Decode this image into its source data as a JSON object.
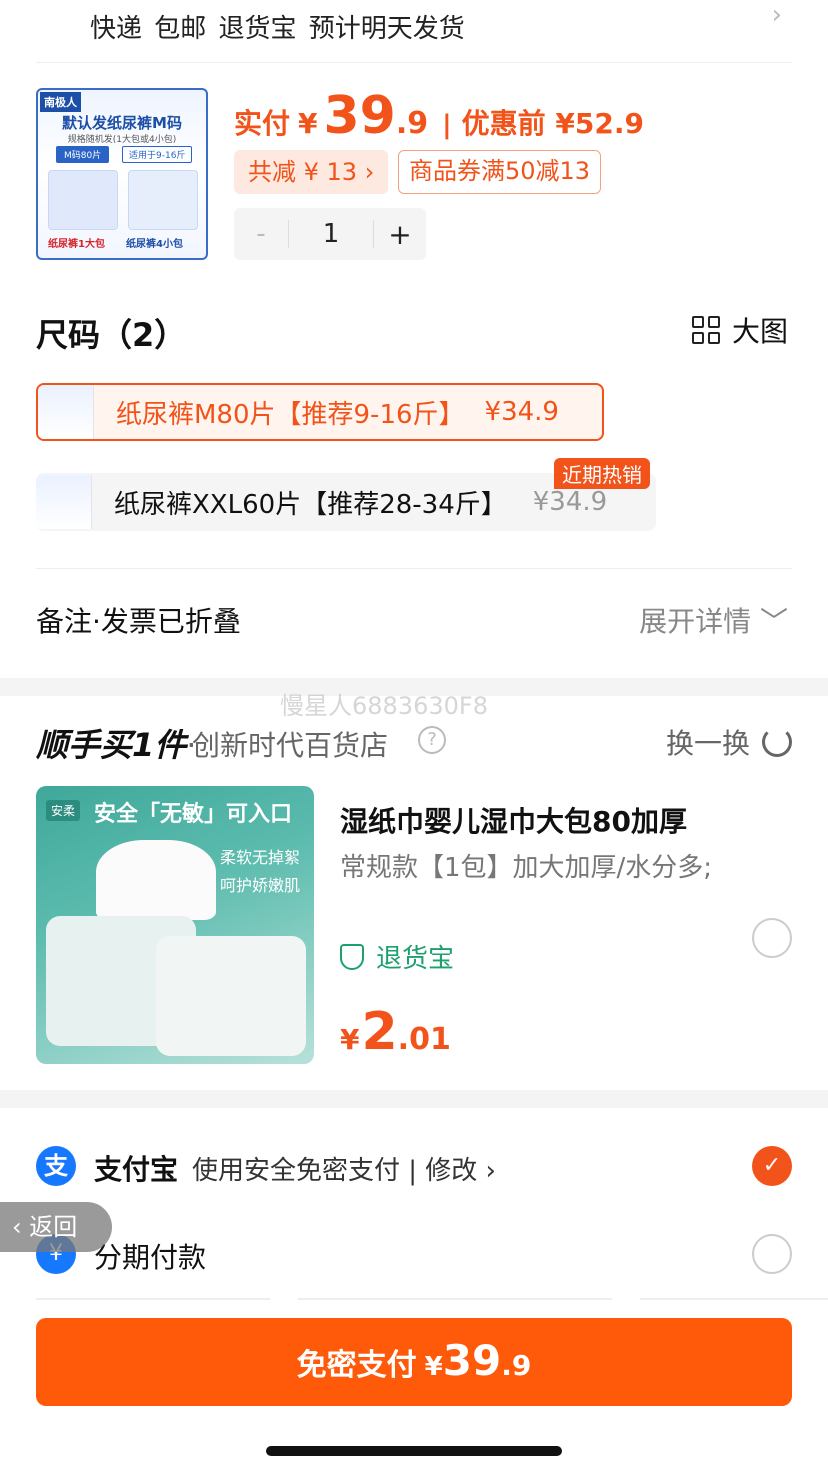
{
  "shipping": {
    "text": "快递 包邮 退货宝 预计明天发货",
    "chevron": "›"
  },
  "product": {
    "image": {
      "brand": "南极人",
      "title": "默认发纸尿裤M码",
      "subtitle": "规格随机发(1大包或4小包)",
      "tag_size": "M码80片",
      "tag_weight": "适用于9-16斤",
      "label_left": "纸尿裤1大包",
      "label_right": "纸尿裤4小包"
    },
    "price_label": "实付",
    "currency": "¥",
    "price_int": "39",
    "price_dec": ".9",
    "separator": "|",
    "before_price": "优惠前 ¥52.9",
    "discount_chip": "共减 ¥ 13 ›",
    "coupon_chip": "商品券满50减13",
    "stepper": {
      "minus": "-",
      "qty": "1",
      "plus": "+"
    }
  },
  "size": {
    "title": "尺码（2）",
    "big_image": "大图",
    "options": [
      {
        "name": "纸尿裤M80片【推荐9-16斤】",
        "price": "¥34.9",
        "selected": true
      },
      {
        "name": "纸尿裤XXL60片【推荐28-34斤】",
        "price": "¥34.9",
        "selected": false
      }
    ],
    "hot_badge": "近期热销"
  },
  "note": {
    "label": "备注·发票已折叠",
    "expand": "展开详情 ﹀"
  },
  "watermark": "慢星人6883630F8",
  "buy_one": {
    "title": "顺手买1件",
    "dot": "·",
    "shop": "创新时代百货店",
    "help": "?",
    "swap": "换一换",
    "item": {
      "image": {
        "tag": "安柔",
        "headline": "安全「无敏」可入口",
        "line1": "柔软无掉絮",
        "line2": "呵护娇嫩肌"
      },
      "title": "湿纸巾婴儿湿巾大包80加厚",
      "spec": "常规款【1包】加大加厚/水分多;",
      "return": "退货宝",
      "currency": "¥",
      "price_int": "2",
      "price_dec": ".01"
    }
  },
  "payment": {
    "alipay_icon": "支",
    "alipay_name": "支付宝",
    "alipay_desc": "使用安全免密支付 | 修改 ›",
    "check": "✓",
    "installment_icon": "¥",
    "installment_name": "分期付款",
    "back": "‹ 返回"
  },
  "pay_button": {
    "label": "免密支付",
    "currency": "¥",
    "price_int": "39",
    "price_dec": ".9"
  },
  "colors": {
    "accent": "#f2531a",
    "button": "#ff5a0a",
    "alipay": "#1677ff",
    "green": "#1ca06d"
  }
}
